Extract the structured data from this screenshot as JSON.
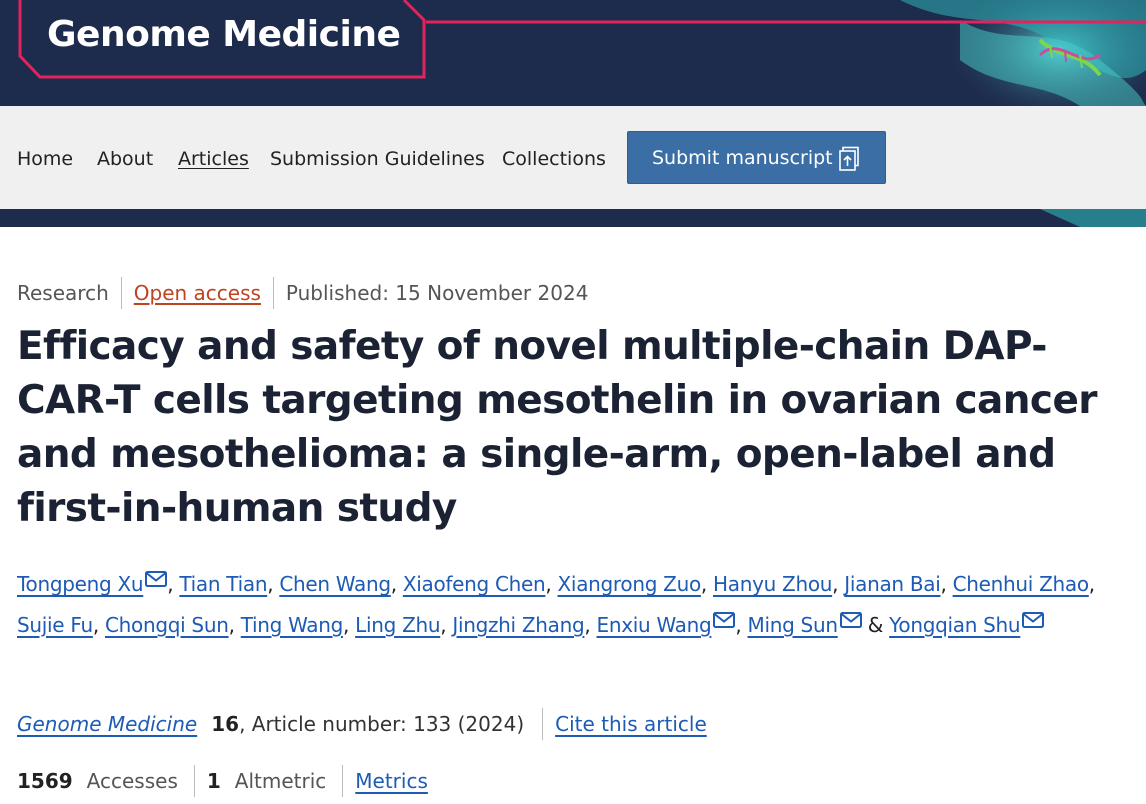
{
  "journal_logo": {
    "text": "Genome Medicine"
  },
  "nav": {
    "items": [
      {
        "label": "Home",
        "active": false
      },
      {
        "label": "About",
        "active": false
      },
      {
        "label": "Articles",
        "active": true
      },
      {
        "label": "Submission Guidelines",
        "active": false
      },
      {
        "label": "Collections",
        "active": false
      }
    ],
    "submit_label": "Submit manuscript",
    "submit_icon": "upload-document-icon"
  },
  "article": {
    "type": "Research",
    "access": "Open access",
    "published": "Published: 15 November 2024",
    "title": "Efficacy and safety of novel multiple-chain DAP-CAR-T cells targeting mesothelin in ovarian cancer and mesothelioma: a single-arm, open-label and first-in-human study",
    "authors": [
      {
        "name": "Tongpeng Xu",
        "email": true
      },
      {
        "name": "Tian Tian",
        "email": false
      },
      {
        "name": "Chen Wang",
        "email": false
      },
      {
        "name": "Xiaofeng Chen",
        "email": false
      },
      {
        "name": "Xiangrong Zuo",
        "email": false
      },
      {
        "name": "Hanyu Zhou",
        "email": false
      },
      {
        "name": "Jianan Bai",
        "email": false
      },
      {
        "name": "Chenhui Zhao",
        "email": false
      },
      {
        "name": "Sujie Fu",
        "email": false
      },
      {
        "name": "Chongqi Sun",
        "email": false
      },
      {
        "name": "Ting Wang",
        "email": false
      },
      {
        "name": "Ling Zhu",
        "email": false
      },
      {
        "name": "Jingzhi Zhang",
        "email": false
      },
      {
        "name": "Enxiu Wang",
        "email": true
      },
      {
        "name": "Ming Sun",
        "email": true
      },
      {
        "name": "Yongqian Shu",
        "email": true
      }
    ],
    "citation": {
      "journal": "Genome Medicine",
      "volume": "16",
      "article_number": ", Article number: 133 (2024)",
      "cite_label": "Cite this article"
    },
    "metrics": {
      "accesses_count": "1569",
      "accesses_label": "Accesses",
      "altmetric_count": "1",
      "altmetric_label": "Altmetric",
      "metrics_link": "Metrics"
    }
  },
  "colors": {
    "navy": "#1d2b4c",
    "accent_pink": "#e0245e",
    "link_blue": "#1d5bb5",
    "open_access_orange": "#c0431f",
    "button_blue": "#3a6ea5"
  }
}
